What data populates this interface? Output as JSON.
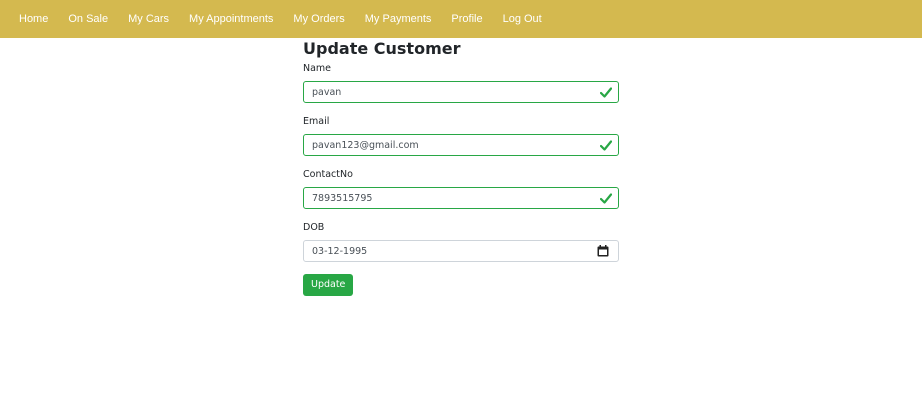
{
  "colors": {
    "navbar_bg": "#d4b94f",
    "valid_border": "#28a745",
    "valid_check": "#28a745",
    "button_bg": "#28a745",
    "default_border": "#ced4da"
  },
  "nav": {
    "items": [
      "Home",
      "On Sale",
      "My Cars",
      "My Appointments",
      "My Orders",
      "My Payments",
      "Profile",
      "Log Out"
    ]
  },
  "form": {
    "title": "Update Customer",
    "name": {
      "label": "Name",
      "value": "pavan",
      "icon": "check-icon"
    },
    "email": {
      "label": "Email",
      "value": "pavan123@gmail.com",
      "icon": "check-icon"
    },
    "contact": {
      "label": "ContactNo",
      "value": "7893515795",
      "icon": "check-icon"
    },
    "dob": {
      "label": "DOB",
      "value": "03-12-1995",
      "icon": "calendar-icon"
    },
    "submit_label": "Update"
  }
}
